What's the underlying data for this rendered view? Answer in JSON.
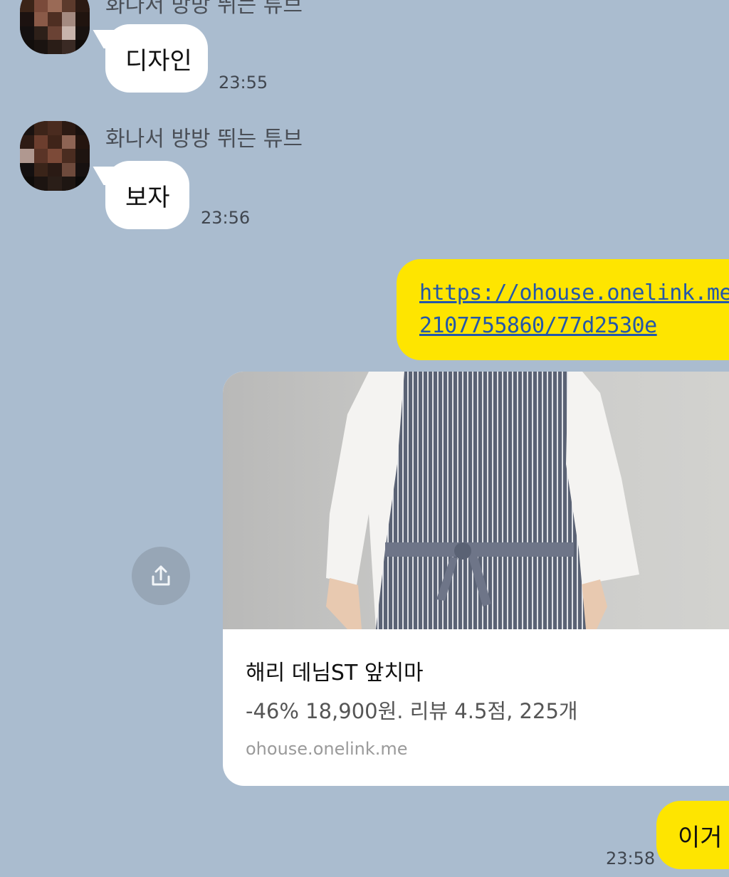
{
  "messages": [
    {
      "sender": "화나서 방방 뛰는 튜브",
      "text": "디자인",
      "time": "23:55"
    },
    {
      "sender": "화나서 방방 뛰는 튜브",
      "text": "보자",
      "time": "23:56"
    }
  ],
  "my_messages": {
    "link_line1": "https://ohouse.onelink.me/",
    "link_line2": "2107755860/77d2530e",
    "card": {
      "title": "해리 데님ST 앞치마",
      "description": "-46% 18,900원. 리뷰 4.5점, 225개",
      "domain": "ohouse.onelink.me"
    },
    "last_text": "이거",
    "last_time": "23:58"
  },
  "icons": {
    "share": "share-icon",
    "avatar": "pixelated-avatar"
  },
  "colors": {
    "background": "#aabccf",
    "my_bubble": "#fee500",
    "their_bubble": "#ffffff",
    "link": "#2457a8"
  }
}
